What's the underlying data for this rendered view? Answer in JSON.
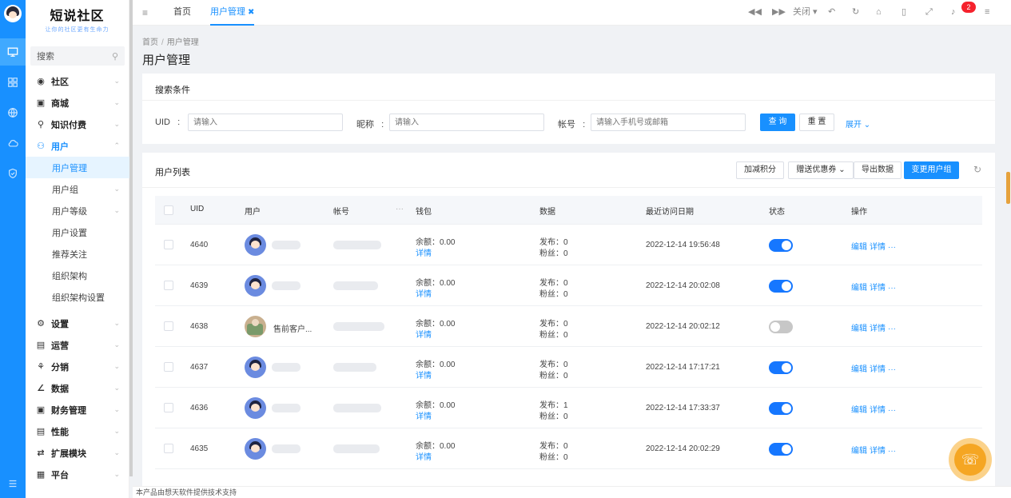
{
  "brand": {
    "title": "短说社区",
    "subtitle": "让你的社区更有生命力"
  },
  "sidebar": {
    "search_placeholder": "搜索",
    "menu": [
      {
        "label": "社区",
        "icon": "chat-icon"
      },
      {
        "label": "商城",
        "icon": "shop-icon"
      },
      {
        "label": "知识付费",
        "icon": "bulb-icon"
      },
      {
        "label": "用户",
        "icon": "users-icon"
      }
    ],
    "user_sub": [
      {
        "label": "用户管理"
      },
      {
        "label": "用户组"
      },
      {
        "label": "用户等级"
      },
      {
        "label": "用户设置"
      },
      {
        "label": "推荐关注"
      },
      {
        "label": "组织架构"
      },
      {
        "label": "组织架构设置"
      }
    ],
    "menu_bottom": [
      {
        "label": "设置",
        "icon": "gear-icon"
      },
      {
        "label": "运营",
        "icon": "monitor-icon"
      },
      {
        "label": "分销",
        "icon": "share-icon"
      },
      {
        "label": "数据",
        "icon": "chart-icon"
      },
      {
        "label": "财务管理",
        "icon": "finance-icon"
      },
      {
        "label": "性能",
        "icon": "doc-icon"
      },
      {
        "label": "扩展模块",
        "icon": "extend-icon"
      },
      {
        "label": "平台",
        "icon": "grid-icon"
      }
    ]
  },
  "topbar": {
    "tabs": [
      {
        "label": "首页"
      },
      {
        "label": "用户管理"
      }
    ],
    "close_label": "关闭",
    "notification_count": "2"
  },
  "page": {
    "breadcrumb": [
      "首页",
      "用户管理"
    ],
    "title": "用户管理"
  },
  "search": {
    "title": "搜索条件",
    "uid_label": "UID",
    "uid_placeholder": "请输入",
    "nick_label": "昵称",
    "nick_placeholder": "请输入",
    "account_label": "帐号",
    "account_placeholder": "请输入手机号或邮箱",
    "query_label": "查 询",
    "reset_label": "重 置",
    "expand_label": "展开"
  },
  "table": {
    "title": "用户列表",
    "actions": {
      "add_points": "加减积分",
      "send_coupon": "赠送优惠券",
      "export": "导出数据",
      "change_group": "变更用户组"
    },
    "headers": {
      "uid": "UID",
      "user": "用户",
      "account": "帐号",
      "wallet": "钱包",
      "data": "数据",
      "last_visit": "最近访问日期",
      "status": "状态",
      "ops": "操作"
    },
    "rows": [
      {
        "uid": "4640",
        "name": "",
        "balance": "余额：0.00",
        "detail": "详情",
        "posts": "发布：0",
        "fans": "粉丝：0",
        "last_visit": "2022-12-14 19:56:48",
        "enabled": true
      },
      {
        "uid": "4639",
        "name": "",
        "balance": "余额：0.00",
        "detail": "详情",
        "posts": "发布：0",
        "fans": "粉丝：0",
        "last_visit": "2022-12-14 20:02:08",
        "enabled": true
      },
      {
        "uid": "4638",
        "name": "售前客户...",
        "balance": "余额：0.00",
        "detail": "详情",
        "posts": "发布：0",
        "fans": "粉丝：0",
        "last_visit": "2022-12-14 20:02:12",
        "enabled": false
      },
      {
        "uid": "4637",
        "name": "",
        "balance": "余额：0.00",
        "detail": "详情",
        "posts": "发布：0",
        "fans": "粉丝：0",
        "last_visit": "2022-12-14 17:17:21",
        "enabled": true
      },
      {
        "uid": "4636",
        "name": "",
        "balance": "余额：0.00",
        "detail": "详情",
        "posts": "发布：1",
        "fans": "粉丝：0",
        "last_visit": "2022-12-14 17:33:37",
        "enabled": true
      },
      {
        "uid": "4635",
        "name": "",
        "balance": "余额：0.00",
        "detail": "详情",
        "posts": "发布：0",
        "fans": "粉丝：0",
        "last_visit": "2022-12-14 20:02:29",
        "enabled": true
      }
    ],
    "row_edit": "编辑",
    "row_detail": "详情",
    "row_more": "···"
  },
  "footer": {
    "text": "本产品由想天软件提供技术支持"
  }
}
